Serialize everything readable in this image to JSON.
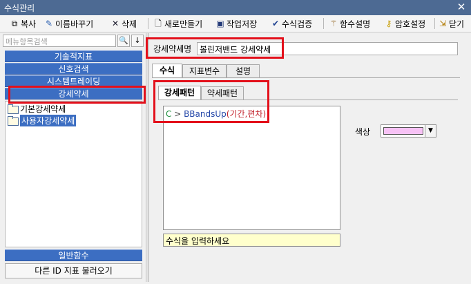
{
  "window": {
    "title": "수식관리",
    "close": "✕"
  },
  "toolbar": {
    "copy": "복사",
    "rename": "이름바꾸기",
    "delete": "삭제",
    "new": "새로만들기",
    "save": "작업저장",
    "verify": "수식검증",
    "func_desc": "함수설명",
    "password": "암호설정",
    "close": "닫기"
  },
  "sidebar": {
    "search_placeholder": "메뉴항목검색",
    "search_btn": "🔍",
    "down_btn": "↓",
    "categories": [
      "기술적지표",
      "신호검색",
      "시스템트레이딩",
      "강세약세"
    ],
    "tree": [
      {
        "label": "기본강세약세",
        "selected": false
      },
      {
        "label": "사용자강세약세",
        "selected": true
      }
    ],
    "general_func": "일반함수",
    "load_other": "다른 ID 지표 불러오기"
  },
  "editor": {
    "name_label": "강세약세명",
    "name_value": "볼린저밴드 강세약세",
    "tabs": [
      "수식",
      "지표변수",
      "설명"
    ],
    "subtabs": [
      "강세패턴",
      "약세패턴"
    ],
    "formula": {
      "c": "C",
      "op": " > ",
      "fn": "BBandsUp",
      "args": "(기간,편차)"
    },
    "hint": "수식을 입력하세요",
    "color_label": "색상",
    "color_value": "#f7c2f5"
  }
}
